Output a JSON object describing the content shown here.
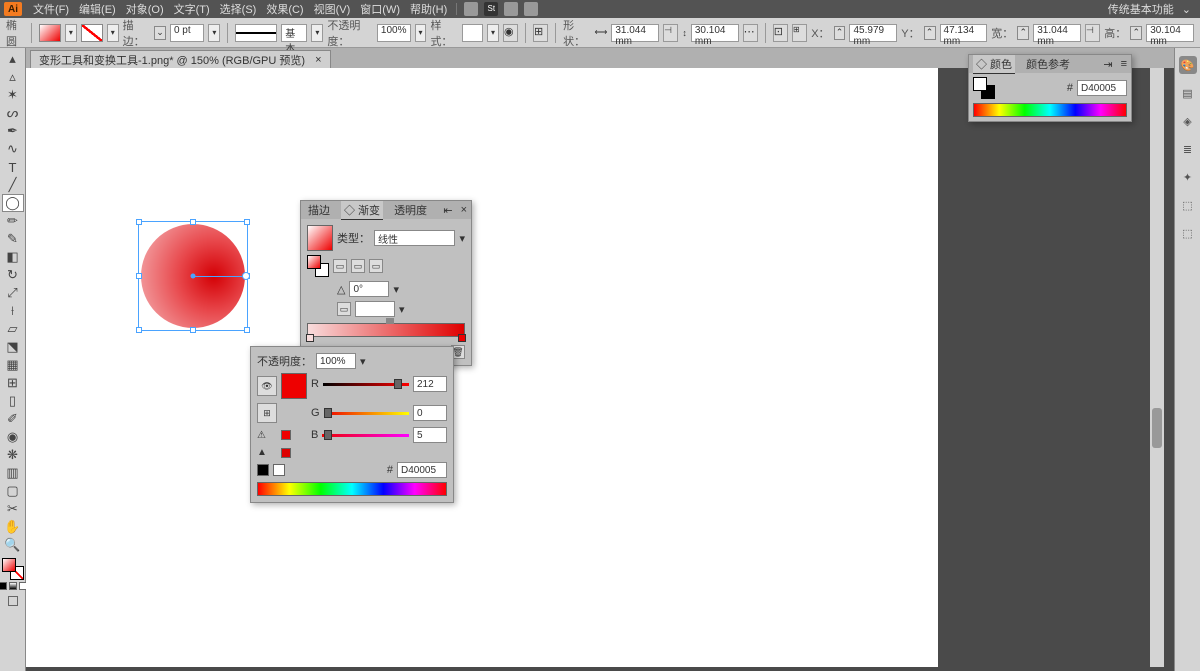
{
  "menu": {
    "items": [
      "文件(F)",
      "编辑(E)",
      "对象(O)",
      "文字(T)",
      "选择(S)",
      "效果(C)",
      "视图(V)",
      "窗口(W)",
      "帮助(H)"
    ],
    "workspace": "传统基本功能"
  },
  "ctrl": {
    "tool_hint": "椭圆",
    "stroke_label": "描边：",
    "stroke_pt": "0 pt",
    "preset_label": "基本",
    "opacity_label": "不透明度：",
    "opacity": "100%",
    "style_label": "样式：",
    "shape_label": "形状：",
    "w": "31.044 mm",
    "h": "30.104 mm",
    "x": "45.979 mm",
    "y": "47.134 mm",
    "w2": "31.044 mm",
    "h2": "30.104 mm",
    "x_lbl": "X：",
    "y_lbl": "Y：",
    "w_lbl": "宽：",
    "h_lbl": "高："
  },
  "tab": {
    "title": "变形工具和变换工具-1.png* @ 150% (RGB/GPU 预览)",
    "close": "×"
  },
  "grad_panel": {
    "tabs": [
      "描边",
      "◇ 渐变",
      "透明度"
    ],
    "type_lbl": "类型：",
    "type_val": "线性",
    "angle_lbl": "△",
    "angle_val": "0°"
  },
  "rgb_panel": {
    "opacity_lbl": "不透明度：",
    "opacity_val": "100%",
    "r_lbl": "R",
    "g_lbl": "G",
    "b_lbl": "B",
    "r": "212",
    "g": "0",
    "b": "5",
    "hex_lbl": "#",
    "hex": "D40005"
  },
  "color_panel": {
    "tabs": [
      "◇ 颜色",
      "颜色参考"
    ],
    "hex_lbl": "#",
    "hex": "D40005"
  },
  "right_icons": [
    "◆",
    "▥",
    "◈",
    "▤",
    "✦",
    "⬚",
    "⬚"
  ]
}
